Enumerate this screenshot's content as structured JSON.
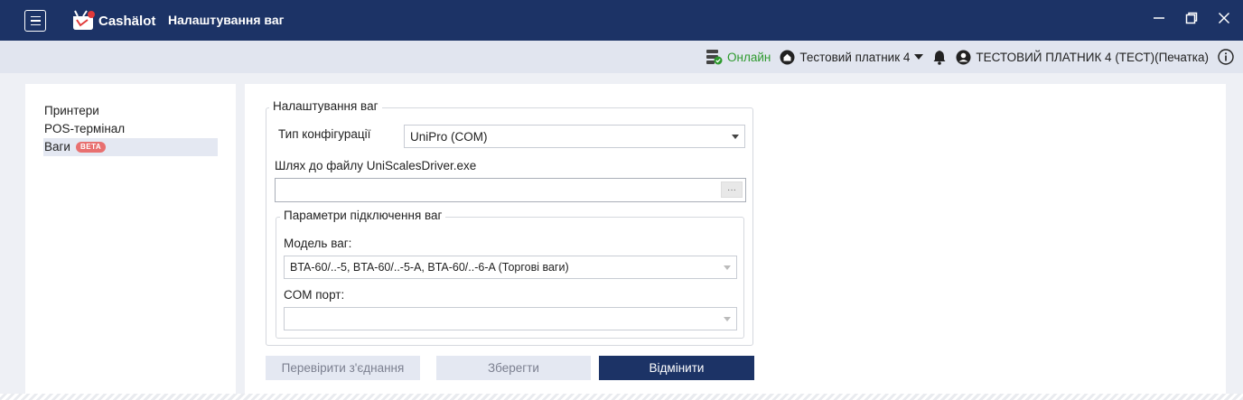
{
  "window": {
    "app_name": "Cashälot",
    "title": "Налаштування ваг"
  },
  "status": {
    "online_label": "Онлайн",
    "taxpayer": "Тестовий платник 4",
    "user": "ТЕСТОВИЙ ПЛАТНИК 4 (ТЕСТ)(Печатка)"
  },
  "colors": {
    "titlebar": "#1c3366",
    "online": "#2e9a2e",
    "beta_badge": "#e87070",
    "primary_button": "#1c3366"
  },
  "sidebar": {
    "items": [
      {
        "label": "Принтери"
      },
      {
        "label": "POS-термінал"
      },
      {
        "label": "Ваги",
        "badge": "BETA"
      }
    ]
  },
  "form": {
    "group_title": "Налаштування ваг",
    "config_type_label": "Тип конфігурації",
    "config_type_value": "UniPro (COM)",
    "path_label": "Шлях до файлу UniScalesDriver.exe",
    "path_value": "",
    "browse_label": "···",
    "connection_group_title": "Параметри підключення ваг",
    "model_label": "Модель ваг:",
    "model_value": "BTA-60/..-5, BTA-60/..-5-A, BTA-60/..-6-A (Торгові ваги)",
    "com_port_label": "COM порт:",
    "com_port_value": ""
  },
  "actions": {
    "test_connection": "Перевірити з'єднання",
    "save": "Зберегти",
    "cancel": "Відмінити"
  }
}
